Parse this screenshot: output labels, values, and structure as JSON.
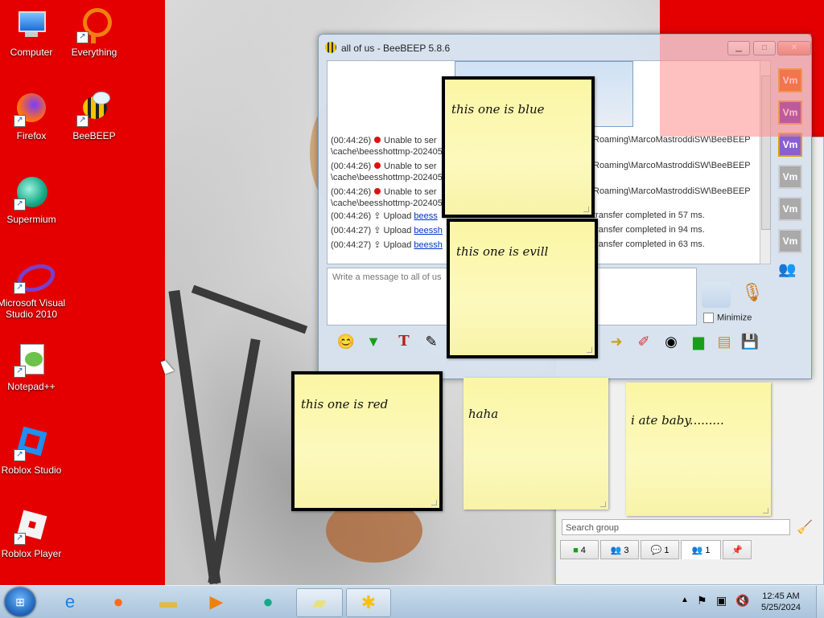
{
  "desktop_icons": [
    {
      "label": "Computer",
      "icon": "computer-icon"
    },
    {
      "label": "Everything",
      "icon": "everything-icon"
    },
    {
      "label": "Firefox",
      "icon": "firefox-icon"
    },
    {
      "label": "BeeBEEP",
      "icon": "beebeep-icon"
    },
    {
      "label": "Supermium",
      "icon": "supermium-icon"
    },
    {
      "label": "Microsoft Visual Studio 2010",
      "icon": "visual-studio-icon"
    },
    {
      "label": "Notepad++",
      "icon": "notepadpp-icon"
    },
    {
      "label": "Roblox Studio",
      "icon": "roblox-studio-icon"
    },
    {
      "label": "Roblox Player",
      "icon": "roblox-player-icon"
    }
  ],
  "window": {
    "title": "all of us - BeeBEEP 5.8.6",
    "input_placeholder": "Write a message to all of us",
    "minimize_label": "Minimize",
    "chat": [
      {
        "time": "(00:44:26)",
        "text": "Unable to ser",
        "path_right": "Roaming\\MarcoMastroddiSW\\BeeBEEP",
        "path2": "\\cache\\beesshottmp-202405"
      },
      {
        "time": "(00:44:26)",
        "text": "Unable to ser",
        "path_right": "Roaming\\MarcoMastroddiSW\\BeeBEEP",
        "path2": "\\cache\\beesshottmp-202405"
      },
      {
        "time": "(00:44:26)",
        "text": "Unable to ser",
        "path_right": "Roaming\\MarcoMastroddiSW\\BeeBEEP",
        "path2": "\\cache\\beesshottmp-202405"
      },
      {
        "time": "(00:44:26)",
        "text": "Upload",
        "link": "beess",
        "right": "transfer completed in 57 ms."
      },
      {
        "time": "(00:44:27)",
        "text": "Upload",
        "link": "beessh",
        "right": "transfer completed in 94 ms."
      },
      {
        "time": "(00:44:27)",
        "text": "Upload",
        "link": "beessh",
        "right": "transfer completed in 63 ms."
      }
    ]
  },
  "sidebar_avatars": [
    {
      "label": "Vm",
      "color": "#e05a00"
    },
    {
      "label": "Vm",
      "color": "#6a1fb0"
    },
    {
      "label": "Vm",
      "color": "#8a5fd0"
    },
    {
      "label": "Vm",
      "color": "#aaaaaa"
    },
    {
      "label": "Vm",
      "color": "#aaaaaa"
    },
    {
      "label": "Vm",
      "color": "#aaaaaa"
    }
  ],
  "panel": {
    "search_placeholder": "Search group",
    "tabs": [
      {
        "icon": "users-icon",
        "count": "4"
      },
      {
        "icon": "group-icon",
        "count": "3"
      },
      {
        "icon": "chat-icon",
        "count": "1"
      },
      {
        "icon": "group-selected-icon",
        "count": "1"
      },
      {
        "icon": "pin-icon",
        "count": ""
      }
    ]
  },
  "notes": [
    {
      "text": "this one is blue"
    },
    {
      "text": "this one is evill"
    },
    {
      "text": "this one is red"
    },
    {
      "text": "haha"
    },
    {
      "text": "i ate baby........."
    }
  ],
  "taskbar": {
    "time": "12:45 AM",
    "date": "5/25/2024",
    "apps": [
      "internet-explorer-icon",
      "firefox-icon",
      "explorer-icon",
      "media-player-icon",
      "supermium-icon",
      "sticky-notes-icon",
      "beebeep-icon"
    ]
  }
}
